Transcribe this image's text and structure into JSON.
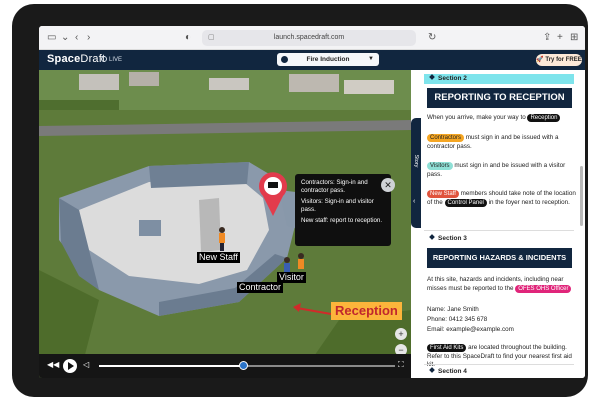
{
  "browser": {
    "url": "launch.spacedraft.com"
  },
  "app": {
    "brand_a": "Space",
    "brand_b": "Draft",
    "live_label": "LIVE",
    "tour_select": "Fire Induction",
    "try_label": "Try for FREE",
    "accent": "#11263f"
  },
  "viewer": {
    "tooltip_lines": [
      "Contractors: Sign-in and contractor pass.",
      "Visitors: Sign-in and visitor pass.",
      "New staff: report to reception."
    ],
    "close_glyph": "✕",
    "labels": {
      "new_staff": "New Staff",
      "visitor": "Visitor",
      "contractor": "Contractor",
      "reception": "Reception"
    },
    "zoom_in": "+",
    "zoom_out": "−",
    "progress": 0.49
  },
  "story_tab": {
    "label": "Story"
  },
  "panel": {
    "section2": {
      "label": "Section 2",
      "title": "REPORTING TO RECEPTION",
      "intro": "When you arrive, make your way to",
      "intro_pill": "Reception",
      "contractors_pill": "Contractors",
      "contractors_text": "must sign in and be issued with a contractor pass.",
      "visitors_pill": "Visitors",
      "visitors_text": "must sign in and be issued with a visitor pass.",
      "newstaff_pill": "New Staff",
      "newstaff_text": "members should take note of the location of the",
      "control_pill": "Control Panel",
      "newstaff_text2": "in the foyer next to reception."
    },
    "section3": {
      "label": "Section 3",
      "title": "REPORTING HAZARDS & INCIDENTS",
      "text": "At this site, hazards and incidents, including near misses must be reported to the",
      "officer_pill": "OFES OHS Officer",
      "name": "Name: Jane Smith",
      "phone": "Phone: 0412 345 678",
      "email": "Email: example@example.com",
      "firstaid_pill": "First Aid Kits",
      "firstaid_text": "are located throughout the building. Refer to this SpaceDraft to find your nearest first aid kit."
    },
    "section4": {
      "label": "Section 4"
    }
  }
}
